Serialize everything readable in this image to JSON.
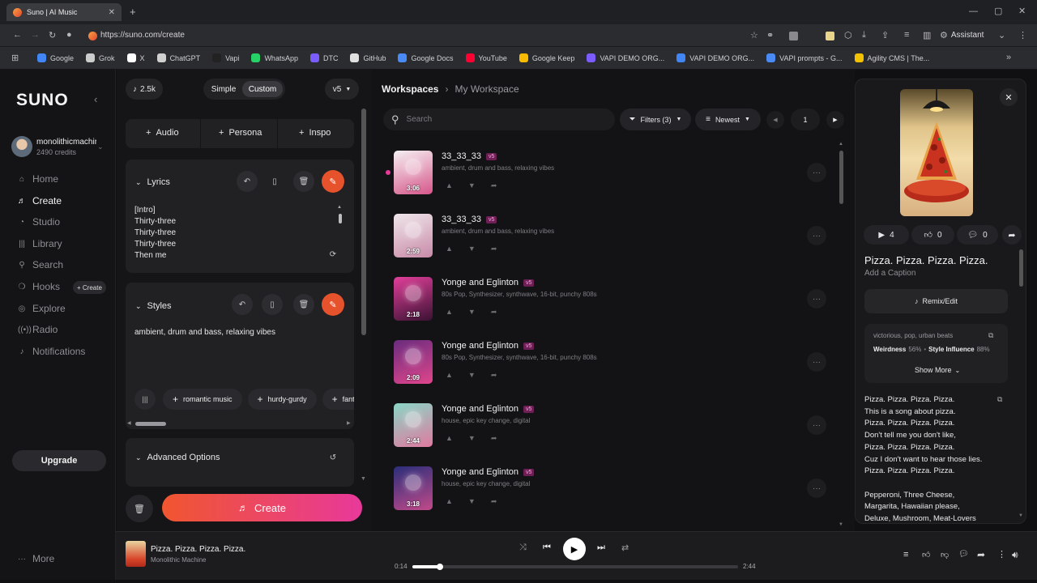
{
  "browser": {
    "tab_title": "Suno | AI Music",
    "url": "https://suno.com/create",
    "assistant_label": "Assistant",
    "bookmarks": [
      {
        "label": "Google",
        "color": "#4285f4"
      },
      {
        "label": "Grok",
        "color": "#cccccc"
      },
      {
        "label": "X",
        "color": "#ffffff"
      },
      {
        "label": "ChatGPT",
        "color": "#d0d0d0"
      },
      {
        "label": "Vapi",
        "color": "#222222"
      },
      {
        "label": "WhatsApp",
        "color": "#25d366"
      },
      {
        "label": "DTC",
        "color": "#7b5cff"
      },
      {
        "label": "GitHub",
        "color": "#e0e0e0"
      },
      {
        "label": "Google Docs",
        "color": "#4a8af4"
      },
      {
        "label": "YouTube",
        "color": "#ff0033"
      },
      {
        "label": "Google Keep",
        "color": "#f9bb00"
      },
      {
        "label": "VAPI DEMO ORG...",
        "color": "#7b5cff"
      },
      {
        "label": "VAPI DEMO ORG...",
        "color": "#4285f4"
      },
      {
        "label": "VAPI prompts - G...",
        "color": "#4a8af4"
      },
      {
        "label": "Agility CMS | The...",
        "color": "#f2c200"
      }
    ]
  },
  "sidebar": {
    "logo": "SUNO",
    "user_name": "monolithicmachir",
    "credits": "2490 credits",
    "nav": [
      {
        "label": "Home",
        "icon": "home-icon",
        "glyph": "⌂"
      },
      {
        "label": "Create",
        "icon": "music-note-icon",
        "glyph": "♬"
      },
      {
        "label": "Studio",
        "icon": "studio-icon",
        "glyph": "◔"
      },
      {
        "label": "Library",
        "icon": "library-icon",
        "glyph": "|||"
      },
      {
        "label": "Search",
        "icon": "search-icon",
        "glyph": "⚲"
      },
      {
        "label": "Hooks",
        "icon": "hooks-icon",
        "glyph": "❍"
      },
      {
        "label": "Explore",
        "icon": "explore-icon",
        "glyph": "◎"
      },
      {
        "label": "Radio",
        "icon": "radio-icon",
        "glyph": "((•))"
      },
      {
        "label": "Notifications",
        "icon": "bell-icon",
        "glyph": "♪"
      }
    ],
    "hooks_create_label": "+ Create",
    "upgrade_label": "Upgrade",
    "more_label": "More"
  },
  "create_panel": {
    "credits_badge": "2.5k",
    "mode_simple": "Simple",
    "mode_custom": "Custom",
    "model": "v5",
    "add_audio": "Audio",
    "add_persona": "Persona",
    "add_inspo": "Inspo",
    "lyrics_label": "Lyrics",
    "lyrics_lines": [
      "[Intro]",
      "Thirty-three",
      "Thirty-three",
      "Thirty-three",
      "Then me"
    ],
    "styles_label": "Styles",
    "styles_text": "ambient, drum and bass, relaxing vibes",
    "style_suggestions": [
      "romantic music",
      "hurdy-gurdy",
      "fanta"
    ],
    "advanced_label": "Advanced Options",
    "create_label": "Create"
  },
  "workspace": {
    "breadcrumb_root": "Workspaces",
    "breadcrumb_current": "My Workspace",
    "search_placeholder": "Search",
    "filters_label": "Filters (3)",
    "sort_label": "Newest",
    "page": "1",
    "songs": [
      {
        "title": "33_33_33",
        "badge": "v5",
        "tags": "ambient, drum and bass, relaxing vibes",
        "duration": "3:06",
        "thumb_a": "#f5f0f2",
        "thumb_b": "#d6568a"
      },
      {
        "title": "33_33_33",
        "badge": "v5",
        "tags": "ambient, drum and bass, relaxing vibes",
        "duration": "2:59",
        "thumb_a": "#efe6ea",
        "thumb_b": "#c88aa8"
      },
      {
        "title": "Yonge and Eglinton",
        "badge": "v5",
        "tags": "80s Pop, Synthesizer, synthwave, 16-bit, punchy 808s",
        "duration": "2:18",
        "thumb_a": "#e23f9a",
        "thumb_b": "#3a1232"
      },
      {
        "title": "Yonge and Eglinton",
        "badge": "v5",
        "tags": "80s Pop, Synthesizer, synthwave, 16-bit, punchy 808s",
        "duration": "2:09",
        "thumb_a": "#6a2c7e",
        "thumb_b": "#e0468c"
      },
      {
        "title": "Yonge and Eglinton",
        "badge": "v5",
        "tags": "house, epic key change, digital",
        "duration": "2:44",
        "thumb_a": "#8ad6c6",
        "thumb_b": "#e07aa0"
      },
      {
        "title": "Yonge and Eglinton",
        "badge": "v5",
        "tags": "house, epic key change, digital",
        "duration": "3:18",
        "thumb_a": "#2a2e7a",
        "thumb_b": "#c24a8a"
      }
    ]
  },
  "detail": {
    "plays": "4",
    "likes": "0",
    "comments": "0",
    "title": "Pizza. Pizza. Pizza. Pizza.",
    "caption_placeholder": "Add a Caption",
    "remix_label": "Remix/Edit",
    "style_tags": "victorious, pop, urban beats",
    "weirdness_label": "Weirdness",
    "weirdness_value": "56%",
    "style_influence_label": "Style Influence",
    "style_influence_value": "88%",
    "show_more": "Show More",
    "lyrics_block1": [
      "Pizza. Pizza. Pizza. Pizza.",
      "This is a song about pizza.",
      "Pizza. Pizza. Pizza. Pizza.",
      "Don't tell me you don't like,",
      "Pizza. Pizza. Pizza. Pizza.",
      "Cuz I don't want to hear those lies.",
      "Pizza. Pizza. Pizza. Pizza."
    ],
    "lyrics_block2": [
      "Pepperoni, Three Cheese,",
      "Margarita, Hawaiian please,",
      "Deluxe, Mushroom, Meat-Lovers"
    ]
  },
  "player": {
    "title": "Pizza. Pizza. Pizza. Pizza.",
    "artist": "Monolithic Machine",
    "elapsed": "0:14",
    "total": "2:44",
    "progress": 0.085
  },
  "colors": {
    "accent": "#e6522c",
    "create_gradient_start": "#f0562f",
    "create_gradient_end": "#e8399a",
    "badge_bg": "#6e1f55"
  }
}
